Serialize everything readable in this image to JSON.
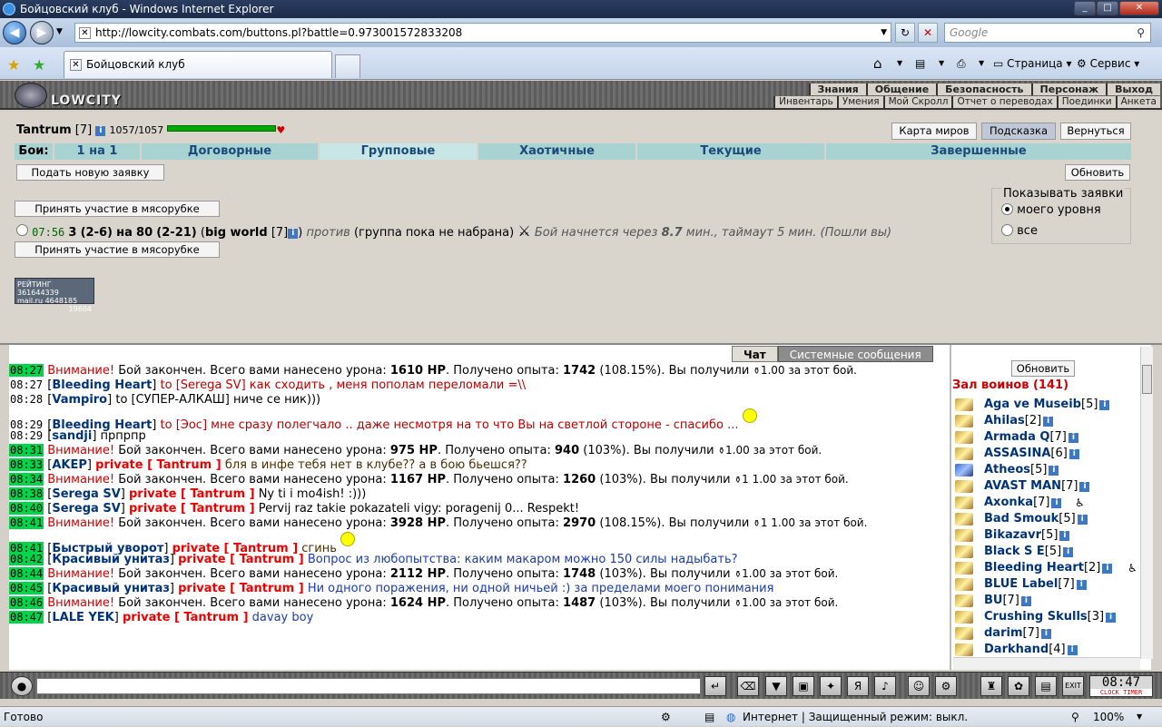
{
  "window": {
    "title": "Бойцовский клуб - Windows Internet Explorer"
  },
  "browser": {
    "url": "http://lowcity.combats.com/buttons.pl?battle=0.973001572833208",
    "search_placeholder": "Google",
    "tab_title": "Бойцовский клуб",
    "tools": {
      "page": "Страница",
      "service": "Сервис"
    }
  },
  "site": {
    "logo": "LOWCITY",
    "menu_top": [
      "Знания",
      "Общение",
      "Безопасность",
      "Персонаж",
      "Выход"
    ],
    "menu_bottom": [
      "Инвентарь",
      "Умения",
      "Мой Скролл",
      "Отчет о переводах",
      "Поединки",
      "Анкета"
    ]
  },
  "player": {
    "name": "Tantrum",
    "level": "[7]",
    "hp": "1057/1057",
    "hp_fraction": 1.0
  },
  "top_buttons": {
    "map": "Карта миров",
    "hint": "Подсказка",
    "back": "Вернуться"
  },
  "fight_nav": {
    "label": "Бои:",
    "tabs": [
      "1 на 1",
      "Договорные",
      "Групповые",
      "Хаотичные",
      "Текущие",
      "Завершенные"
    ],
    "active": "Групповые"
  },
  "actions": {
    "new_request": "Подать новую заявку",
    "refresh": "Обновить",
    "join": "Принять участие в мясорубке"
  },
  "show_filter": {
    "legend": "Показывать заявки",
    "options": [
      "моего уровня",
      "все"
    ],
    "selected": "моего уровня"
  },
  "battle": {
    "time": "07:56",
    "n1": "3",
    "r1a": "2",
    "r1b": "6",
    "n2": "80",
    "r2a": "2",
    "r2b": "21",
    "team": "big world",
    "team_level": "[7]",
    "vs": "против",
    "status": "(группа пока не набрана)",
    "start_text": "Бой начнется через",
    "minutes": "8.7",
    "rest": "мин., таймаут 5 мин. (Пошли вы)"
  },
  "counter": {
    "line1": "РЕЙТИНГ 361644339",
    "line2": "mail.ru 4648185",
    "line3": "19604"
  },
  "chat_tabs": [
    "Чат",
    "Системные сообщения"
  ],
  "chat": [
    {
      "time": "08:27",
      "hl": true,
      "type": "sys",
      "warn": "Внимание!",
      "a": "Бой закончен. Всего вами нанесено урона:",
      "dmg": "1610 HP",
      "b": ". Получено опыта:",
      "exp": "1742",
      "c": "(108.15%). Вы получили",
      "d": "1.00 за этот бой."
    },
    {
      "time": "08:27",
      "hl": false,
      "type": "msg",
      "nick": "Bleeding Heart",
      "to": "to [Serega SV]",
      "text": "как сходить , меня пополам переломали =\\\\",
      "cls": "red"
    },
    {
      "time": "08:28",
      "hl": false,
      "type": "msg",
      "nick": "Vampiro",
      "to": "to [СУПЕР-АЛКАШ]",
      "text": "ниче се ник)))",
      "cls": ""
    },
    {
      "time": "08:29",
      "hl": false,
      "type": "msg",
      "gap": true,
      "nick": "Bleeding Heart",
      "to": "to [Эос]",
      "text": "мне сразу полегчало .. даже несмотря на то что Вы на светлой стороне - спасибо ...",
      "cls": "red",
      "smiley": "smiley-icon"
    },
    {
      "time": "08:29",
      "hl": false,
      "type": "msg",
      "nick": "sandji",
      "to": "",
      "text": "прпрпр",
      "cls": ""
    },
    {
      "time": "08:31",
      "hl": true,
      "type": "sys",
      "warn": "Внимание!",
      "a": "Бой закончен. Всего вами нанесено урона:",
      "dmg": "975 HP",
      "b": ". Получено опыта:",
      "exp": "940",
      "c": "(103%). Вы получили",
      "d": "1.00 за этот бой."
    },
    {
      "time": "08:33",
      "hl": true,
      "type": "priv",
      "nick": "AKEP",
      "priv": "private [ Tantrum ]",
      "text": "бля в инфе тебя нет в клубе?? а в бою бьешся??",
      "cls": "dk"
    },
    {
      "time": "08:34",
      "hl": true,
      "type": "sys",
      "warn": "Внимание!",
      "a": "Бой закончен. Всего вами нанесено урона:",
      "dmg": "1167 HP",
      "b": ". Получено опыта:",
      "exp": "1260",
      "c": "(103%). Вы получили",
      "d": "1 1.00 за этот бой."
    },
    {
      "time": "08:38",
      "hl": true,
      "type": "priv",
      "nick": "Serega SV",
      "priv": "private [ Tantrum ]",
      "text": "Ny ti i mo4ish! :)))",
      "cls": ""
    },
    {
      "time": "08:40",
      "hl": true,
      "type": "priv",
      "nick": "Serega SV",
      "priv": "private [ Tantrum ]",
      "text": "Pervij raz takie pokazateli vigy: poragenij 0... Respekt!",
      "cls": ""
    },
    {
      "time": "08:41",
      "hl": true,
      "type": "sys",
      "warn": "Внимание!",
      "a": "Бой закончен. Всего вами нанесено урона:",
      "dmg": "3928 HP",
      "b": ". Получено опыта:",
      "exp": "2970",
      "c": "(108.15%). Вы получили",
      "d": "1 1.00 за этот бой."
    },
    {
      "time": "08:41",
      "hl": true,
      "type": "priv",
      "gap": true,
      "nick": "Быстрый уворот",
      "priv": "private [ Tantrum ]",
      "text": "сгинь",
      "cls": "dk",
      "smiley": "laughing-smiley-icon"
    },
    {
      "time": "08:42",
      "hl": true,
      "type": "priv",
      "nick": "Красивый унитаз",
      "priv": "private [ Tantrum ]",
      "text": "Вопрос из любопытства: каким макаром можно 150 силы надыбать?",
      "cls": "blue"
    },
    {
      "time": "08:44",
      "hl": true,
      "type": "sys",
      "warn": "Внимание!",
      "a": "Бой закончен. Всего вами нанесено урона:",
      "dmg": "2112 HP",
      "b": ". Получено опыта:",
      "exp": "1748",
      "c": "(103%). Вы получили",
      "d": "1.00 за этот бой."
    },
    {
      "time": "08:45",
      "hl": true,
      "type": "priv",
      "nick": "Красивый унитаз",
      "priv": "private [ Tantrum ]",
      "text": "Ни одного поражения, ни одной ничьей :) за пределами моего понимания",
      "cls": "blue"
    },
    {
      "time": "08:46",
      "hl": true,
      "type": "sys",
      "warn": "Внимание!",
      "a": "Бой закончен. Всего вами нанесено урона:",
      "dmg": "1624 HP",
      "b": ". Получено опыта:",
      "exp": "1487",
      "c": "(103%). Вы получили",
      "d": "1.00 за этот бой."
    },
    {
      "time": "08:47",
      "hl": true,
      "type": "priv",
      "nick": "LALE YEK",
      "priv": "private [ Tantrum ]",
      "text": "davay boy",
      "cls": "blue"
    }
  ],
  "sidebar": {
    "refresh": "Обновить",
    "hall": "Зал воинов (141)",
    "users": [
      {
        "name": "Aga ve Museib",
        "lvl": "[5]"
      },
      {
        "name": "Ahilas",
        "lvl": "[2]"
      },
      {
        "name": "Armada Q",
        "lvl": "[7]"
      },
      {
        "name": "ASSASINA",
        "lvl": "[6]"
      },
      {
        "name": "Atheos",
        "lvl": "[5]",
        "blue": true
      },
      {
        "name": "AVAST MAN",
        "lvl": "[7]"
      },
      {
        "name": "Axonka",
        "lvl": "[7]",
        "wheel": true
      },
      {
        "name": "Bad Smouk",
        "lvl": "[5]"
      },
      {
        "name": "Bikazavr",
        "lvl": "[5]"
      },
      {
        "name": "Black S E",
        "lvl": "[5]"
      },
      {
        "name": "Bleeding Heart",
        "lvl": "[2]",
        "wheel": true
      },
      {
        "name": "BLUE Label",
        "lvl": "[7]"
      },
      {
        "name": "BU",
        "lvl": "[7]"
      },
      {
        "name": "Crushing Skulls",
        "lvl": "[3]"
      },
      {
        "name": "darim",
        "lvl": "[7]"
      },
      {
        "name": "Darkhand",
        "lvl": "[4]"
      }
    ]
  },
  "clock": {
    "time": "08:47",
    "sub": "CLOCK TIMER"
  },
  "status": {
    "left": "Готово",
    "zone": "Интернет | Защищенный режим: выкл.",
    "zoom": "100%"
  }
}
